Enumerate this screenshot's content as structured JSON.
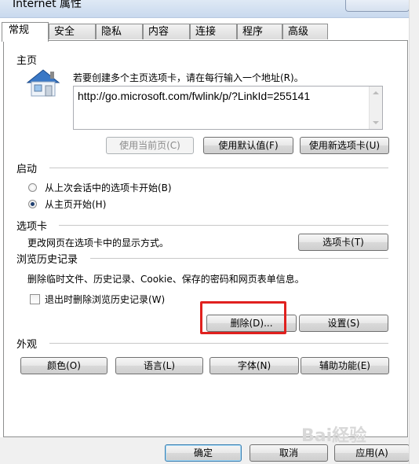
{
  "window": {
    "title": "Internet 属性"
  },
  "tabs": [
    "常规",
    "安全",
    "隐私",
    "内容",
    "连接",
    "程序",
    "高级"
  ],
  "home": {
    "heading": "主页",
    "instruction": "若要创建多个主页选项卡，请在每行输入一个地址(R)。",
    "url": "http://go.microsoft.com/fwlink/p/?LinkId=255141",
    "btn_current": "使用当前页(C)",
    "btn_default": "使用默认值(F)",
    "btn_newtab": "使用新选项卡(U)"
  },
  "startup": {
    "heading": "启动",
    "option1": "从上次会话中的选项卡开始(B)",
    "option2": "从主页开始(H)",
    "selected": "option2"
  },
  "tabs_section": {
    "heading": "选项卡",
    "description": "更改网页在选项卡中的显示方式。",
    "btn": "选项卡(T)"
  },
  "history": {
    "heading": "浏览历史记录",
    "description": "删除临时文件、历史记录、Cookie、保存的密码和网页表单信息。",
    "checkbox": "退出时删除浏览历史记录(W)",
    "btn_delete": "删除(D)...",
    "btn_settings": "设置(S)"
  },
  "appearance": {
    "heading": "外观",
    "btn_colors": "颜色(O)",
    "btn_languages": "语言(L)",
    "btn_fonts": "字体(N)",
    "btn_accessibility": "辅助功能(E)"
  },
  "footer": {
    "ok": "确定",
    "cancel": "取消",
    "apply": "应用(A)"
  },
  "watermark": "Bai経验",
  "colors": {
    "highlight": "#e0211f",
    "selected_radio": "#1f3f6f"
  }
}
